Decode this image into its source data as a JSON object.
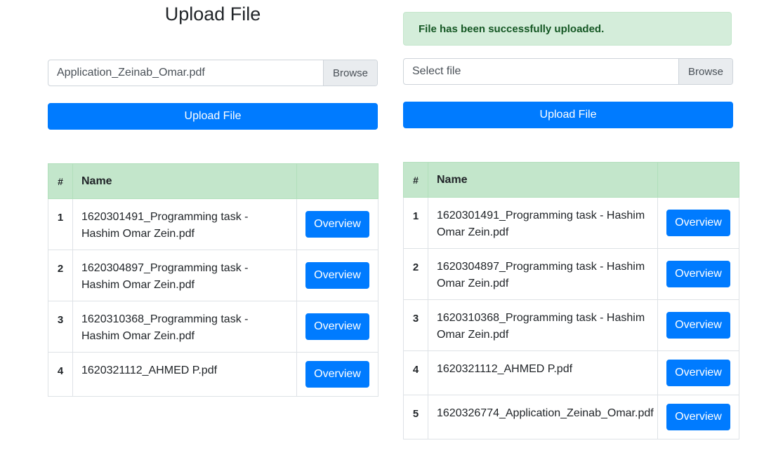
{
  "left": {
    "title": "Upload File",
    "file_input": {
      "value": "Application_Zeinab_Omar.pdf",
      "browse_label": "Browse"
    },
    "upload_label": "Upload File",
    "table": {
      "headers": [
        "#",
        "Name",
        ""
      ],
      "rows": [
        {
          "num": "1",
          "name": "1620301491_Programming task - Hashim Omar Zein.pdf",
          "action": "Overview"
        },
        {
          "num": "2",
          "name": "1620304897_Programming task - Hashim Omar Zein.pdf",
          "action": "Overview"
        },
        {
          "num": "3",
          "name": "1620310368_Programming task - Hashim Omar Zein.pdf",
          "action": "Overview"
        },
        {
          "num": "4",
          "name": "1620321112_AHMED P.pdf",
          "action": "Overview"
        }
      ]
    }
  },
  "right": {
    "alert": "File has been successfully uploaded.",
    "file_input": {
      "placeholder": "Select file",
      "browse_label": "Browse"
    },
    "upload_label": "Upload File",
    "table": {
      "headers": [
        "#",
        "Name",
        ""
      ],
      "rows": [
        {
          "num": "1",
          "name": "1620301491_Programming task - Hashim Omar Zein.pdf",
          "action": "Overview"
        },
        {
          "num": "2",
          "name": "1620304897_Programming task - Hashim Omar Zein.pdf",
          "action": "Overview"
        },
        {
          "num": "3",
          "name": "1620310368_Programming task - Hashim Omar Zein.pdf",
          "action": "Overview"
        },
        {
          "num": "4",
          "name": "1620321112_AHMED P.pdf",
          "action": "Overview"
        },
        {
          "num": "5",
          "name": "1620326774_Application_Zeinab_Omar.pdf",
          "action": "Overview"
        }
      ]
    }
  },
  "colors": {
    "primary": "#007bff",
    "table_header": "#c3e6cb",
    "alert_bg": "#d4edda",
    "alert_text": "#155724"
  }
}
